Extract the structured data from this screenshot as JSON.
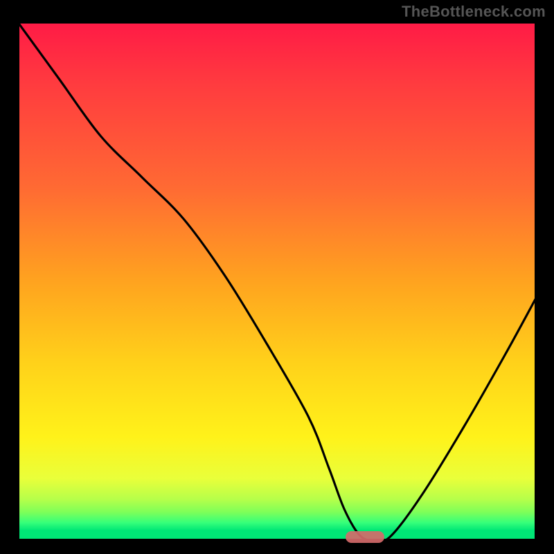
{
  "watermark": "TheBottleneck.com",
  "colors": {
    "gradient_top": "#ff1a46",
    "gradient_mid1": "#ffa31f",
    "gradient_mid2": "#fff21a",
    "gradient_bottom": "#00e676",
    "marker": "#d46a6a",
    "curve": "#000000"
  },
  "chart_data": {
    "type": "line",
    "title": "",
    "xlabel": "",
    "ylabel": "",
    "xlim": [
      0,
      100
    ],
    "ylim": [
      0,
      100
    ],
    "grid": false,
    "legend": false,
    "series": [
      {
        "name": "bottleneck-curve",
        "x": [
          0,
          8,
          16,
          24,
          32,
          40,
          48,
          56,
          60,
          63,
          66,
          69,
          72,
          78,
          86,
          94,
          100
        ],
        "y": [
          100,
          89,
          78,
          70,
          62,
          51,
          38,
          24,
          14,
          6,
          1,
          0,
          1,
          9,
          22,
          36,
          47
        ]
      }
    ],
    "optimum_marker": {
      "x_center": 67,
      "width_pct": 7.5
    },
    "notes": "Background is a vertical heat gradient red→yellow→green. Curve is a black V-shaped line indicating bottleneck severity; minimum (optimal) lies around x≈67 marked by a small rounded pink bar at the bottom."
  }
}
